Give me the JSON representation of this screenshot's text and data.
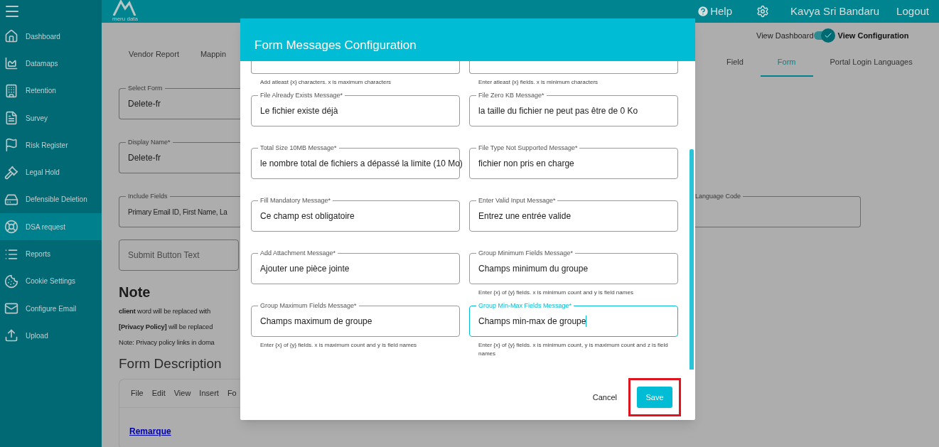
{
  "sidebar": {
    "items": [
      {
        "label": "Dashboard",
        "selected": false
      },
      {
        "label": "Datamaps",
        "selected": false
      },
      {
        "label": "Retention",
        "selected": false
      },
      {
        "label": "Survey",
        "selected": false
      },
      {
        "label": "Risk Register",
        "selected": false
      },
      {
        "label": "Legal Hold",
        "selected": false
      },
      {
        "label": "Defensible Deletion",
        "selected": false
      },
      {
        "label": "DSA request",
        "selected": true
      },
      {
        "label": "Reports",
        "selected": false
      },
      {
        "label": "Cookie Settings",
        "selected": false
      },
      {
        "label": "Configure Email",
        "selected": false
      },
      {
        "label": "Upload",
        "selected": false
      }
    ]
  },
  "header": {
    "logo_text": "meru data",
    "help": "Help",
    "user": "Kavya Sri Bandaru",
    "logout": "Logout"
  },
  "view_toggle": {
    "left_label": "View Dashboard",
    "right_label": "View Configuration",
    "on": true
  },
  "tabs_left": [
    {
      "label": "Vendor Report",
      "selected": false
    },
    {
      "label": "Mappin",
      "selected": false
    }
  ],
  "tabs_right": [
    {
      "label": "Field",
      "selected": false
    },
    {
      "label": "Form",
      "selected": true
    },
    {
      "label": "Portal Login Languages",
      "selected": false
    }
  ],
  "form": {
    "select_form": {
      "label": "Select Form",
      "value": "Delete-fr"
    },
    "display_name": {
      "label": "Display Name*",
      "value": "Delete-fr"
    },
    "include_fields": {
      "label": "Include Fields",
      "value": "Primary Email ID, First Name, La"
    },
    "language_code": {
      "label": "Language Code"
    },
    "submit_button_text": {
      "placeholder": "Submit Button Text"
    }
  },
  "note": {
    "title": "Note",
    "lines": [
      "**client** word will be replaced with",
      "**[Privacy Policy]** will be replaced",
      "Note: Privacy policy links in doma"
    ]
  },
  "form_description": {
    "title": "Form Description",
    "menu": [
      "File",
      "Edit",
      "View",
      "Insert",
      "Fo"
    ],
    "content_link": "Remarque"
  },
  "modal": {
    "title": "Form Messages Configuration",
    "fields": [
      {
        "kind": "partial",
        "helper": "Add atleast {x} characters. x is maximum characters",
        "focused": false
      },
      {
        "kind": "partial",
        "helper": "Enter atleast {x} fields. x is minimum characters",
        "focused": false
      },
      {
        "kind": "text",
        "label": "File Already Exists Message*",
        "value": "Le fichier existe déjà",
        "focused": false
      },
      {
        "kind": "text",
        "label": "File Zero KB Message*",
        "value": "la taille du fichier ne peut pas être de 0 Ko",
        "focused": false
      },
      {
        "kind": "text",
        "label": "Total Size 10MB Message*",
        "value": "le nombre total de fichiers a dépassé la limite (10 Mo)",
        "focused": false
      },
      {
        "kind": "text",
        "label": "File Type Not Supported Message*",
        "value": "fichier non pris en charge",
        "focused": false
      },
      {
        "kind": "text",
        "label": "Fill Mandatory Message*",
        "value": "Ce champ est obligatoire",
        "focused": false
      },
      {
        "kind": "text",
        "label": "Enter Valid Input Message*",
        "value": "Entrez une entrée valide",
        "focused": false
      },
      {
        "kind": "text",
        "label": "Add Attachment Message*",
        "value": "Ajouter une pièce jointe",
        "focused": false
      },
      {
        "kind": "text",
        "label": "Group Minimum Fields Message*",
        "value": "Champs minimum du groupe",
        "helper": "Enter {x} of {y} fields. x is minimum count and y is field names",
        "focused": false
      },
      {
        "kind": "text",
        "label": "Group Maximum Fields Message*",
        "value": "Champs maximum de groupe",
        "helper": "Enter {x} of {y} fields. x is maximum count and y is field names",
        "focused": false
      },
      {
        "kind": "text",
        "label": "Group Min-Max Fields Message*",
        "value": "Champs min-max de groupe",
        "helper": "Enter {x} of {y} fields. x is minimum count, y is maximum count and z is field names",
        "focused": true
      }
    ],
    "cancel": "Cancel",
    "save": "Save",
    "save_highlighted": true
  }
}
